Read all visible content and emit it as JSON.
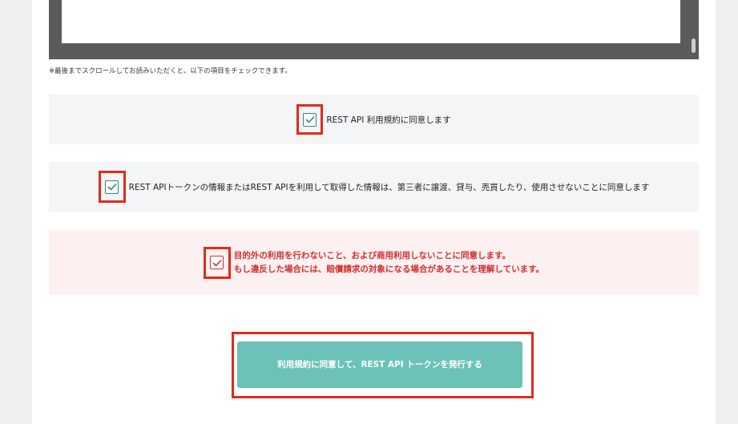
{
  "note": "※最後までスクロールしてお読みいただくと、以下の項目をチェックできます。",
  "checks": [
    {
      "label": "REST API 利用規約に同意します",
      "checked": true
    },
    {
      "label": "REST APIトークンの情報またはREST APIを利用して取得した情報は、第三者に譲渡、貸与、売買したり、使用させないことに同意します",
      "checked": true
    },
    {
      "line1": "目的外の利用を行わないこと、および商用利用しないことに同意します。",
      "line2": "もし違反した場合には、賠償請求の対象になる場合があることを理解しています。",
      "checked": true
    }
  ],
  "submit_label": "利用規約に同意して、REST API トークンを発行する",
  "colors": {
    "accent": "#6cc2b6",
    "check": "#2e8a7b",
    "warn": "#d22d2d",
    "highlight": "#e02b1d"
  }
}
